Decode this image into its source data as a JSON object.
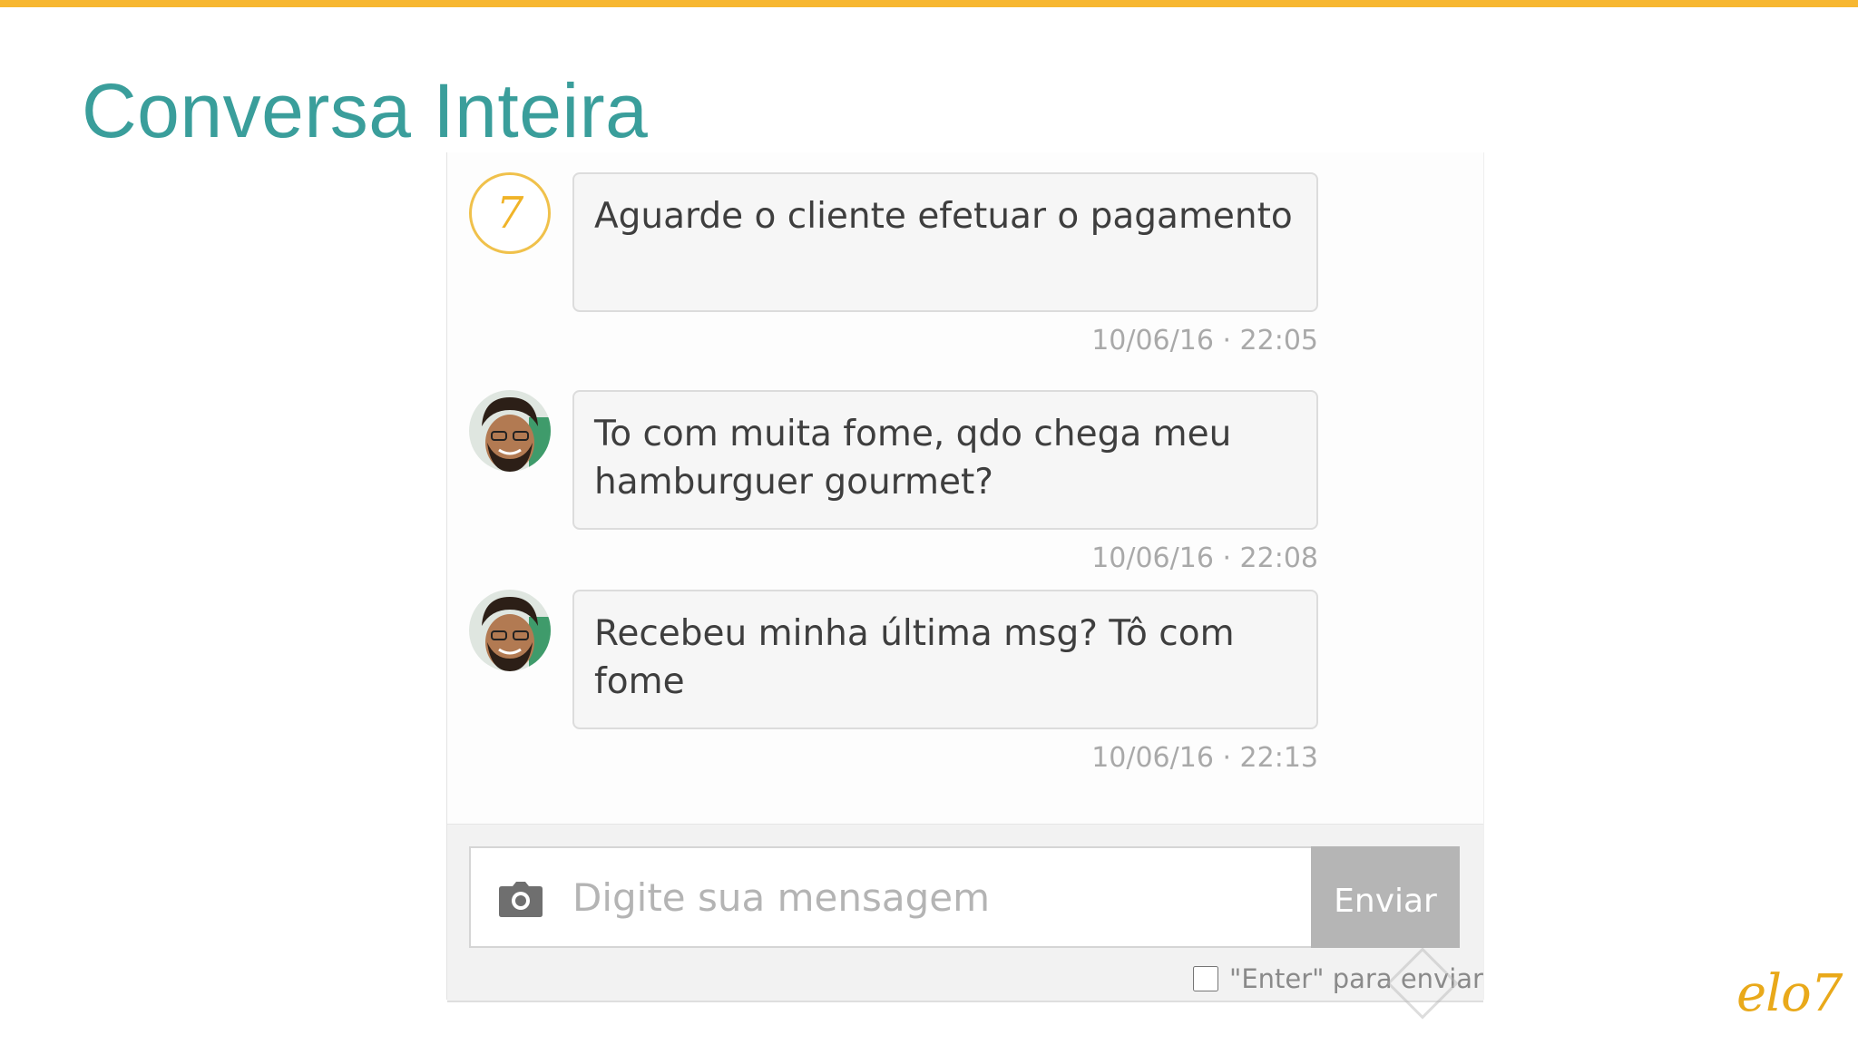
{
  "slide": {
    "title": "Conversa Inteira",
    "accent_color": "#f7b731",
    "title_color": "#3a9e9b"
  },
  "chat": {
    "messages": [
      {
        "sender": "shop",
        "avatar_icon": "shop-logo-icon",
        "avatar_text": "7",
        "text": "Aguarde o cliente efetuar o pagamento",
        "timestamp": "10/06/16 · 22:05"
      },
      {
        "sender": "customer",
        "avatar_icon": "user-avatar-icon",
        "text": "To com muita fome, qdo chega meu hamburguer gourmet?",
        "timestamp": "10/06/16 · 22:08"
      },
      {
        "sender": "customer",
        "avatar_icon": "user-avatar-icon",
        "text": "Recebeu minha última msg? Tô com fome",
        "timestamp": "10/06/16 · 22:13"
      }
    ]
  },
  "composer": {
    "placeholder": "Digite sua mensagem",
    "camera_icon": "camera-icon",
    "send_label": "Enviar",
    "enter_option_label": "\"Enter\" para enviar"
  },
  "branding": {
    "logo_text": "elo7",
    "logo_color": "#e9a91a"
  }
}
